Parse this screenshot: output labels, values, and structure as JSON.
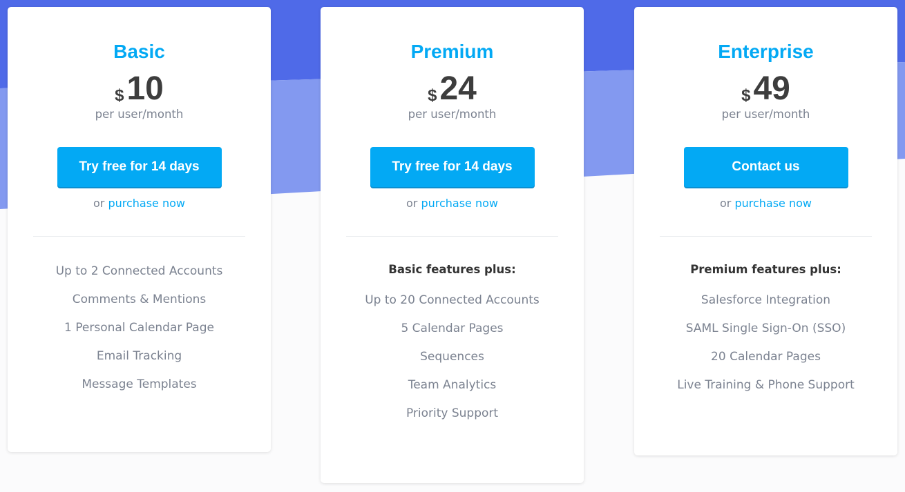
{
  "colors": {
    "accent": "#03a9f4",
    "bg_dark": "#4f6ae8",
    "bg_light": "#8399f0"
  },
  "plans": [
    {
      "name": "Basic",
      "currency": "$",
      "price": "10",
      "period": "per user/month",
      "cta": "Try free for 14 days",
      "or": "or",
      "purchase": "purchase now",
      "features_head": "",
      "features": [
        "Up to 2 Connected Accounts",
        "Comments & Mentions",
        "1 Personal Calendar Page",
        "Email Tracking",
        "Message Templates"
      ]
    },
    {
      "name": "Premium",
      "currency": "$",
      "price": "24",
      "period": "per user/month",
      "cta": "Try free for 14 days",
      "or": "or",
      "purchase": "purchase now",
      "features_head": "Basic features plus:",
      "features": [
        "Up to 20 Connected Accounts",
        "5 Calendar Pages",
        "Sequences",
        "Team Analytics",
        "Priority Support"
      ]
    },
    {
      "name": "Enterprise",
      "currency": "$",
      "price": "49",
      "period": "per user/month",
      "cta": "Contact us",
      "or": "or",
      "purchase": "purchase now",
      "features_head": "Premium features plus:",
      "features": [
        "Salesforce Integration",
        "SAML Single Sign-On (SSO)",
        "20 Calendar Pages",
        "Live Training & Phone Support"
      ]
    }
  ]
}
